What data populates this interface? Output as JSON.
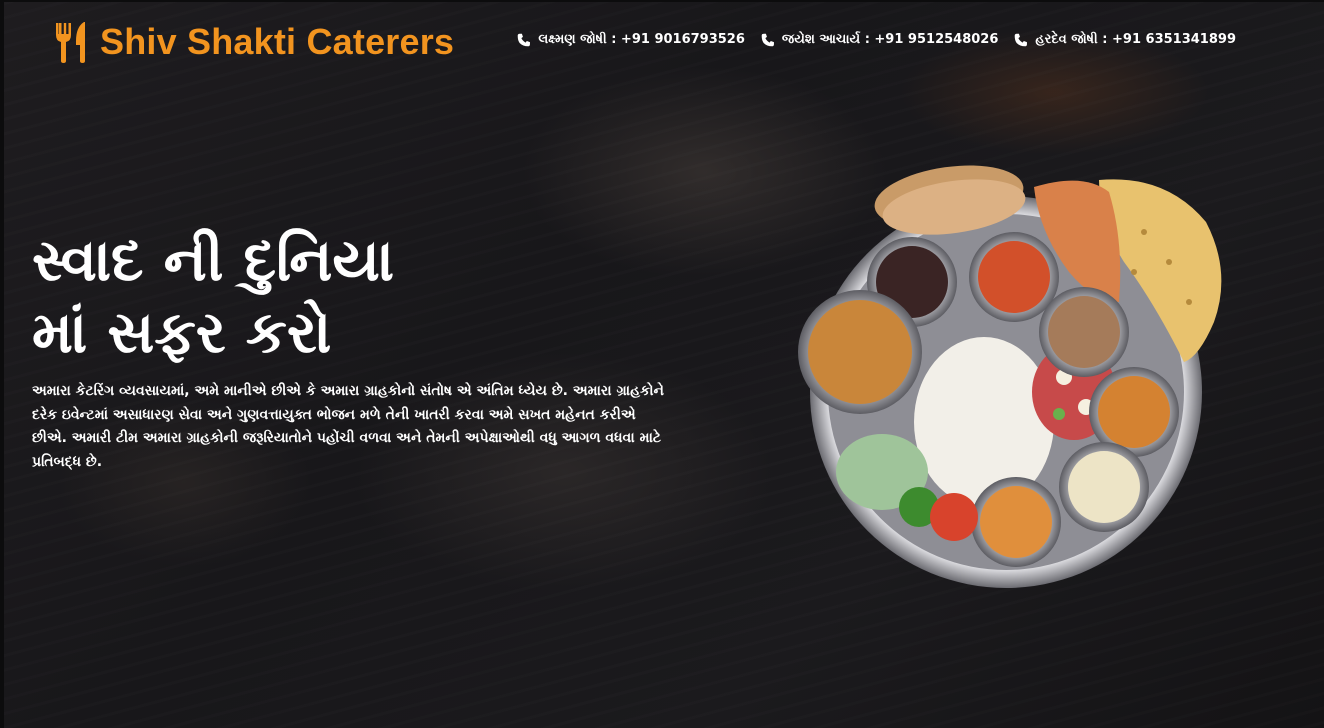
{
  "brand": {
    "name": "Shiv Shakti Caterers",
    "logo_icon": "fork-knife-icon",
    "color": "#f2941f"
  },
  "contacts": [
    {
      "icon": "phone-icon",
      "label": "લક્ષ્મણ જોષી : +91 9016793526"
    },
    {
      "icon": "phone-icon",
      "label": "જયેશ આચાર્ય : +91 9512548026"
    },
    {
      "icon": "phone-icon",
      "label": "હરદેવ જોષી : +91 6351341899"
    }
  ],
  "hero": {
    "title_line1": "સ્વાદ ની દુનિયા",
    "title_line2": "માં સફર કરો",
    "description": "અમારા કેટરિંગ વ્યવસાયમાં, અમે માનીએ છીએ કે અમારા ગ્રાહકોનો સંતોષ એ અંતિમ ધ્યેય છે. અમારા ગ્રાહકોને દરેક ઇવેન્ટમાં અસાધારણ સેવા અને ગુણવત્તાયુક્ત ભોજન મળે તેની ખાતરી કરવા અમે સખત મહેનત કરીએ છીએ. અમારી ટીમ અમારા ગ્રાહકોની જરૂરિયાતોને પહોંચી વળવા અને તેમની અપેક્ષાઓથી વધુ આગળ વધવા માટે પ્રતિબદ્ધ છે.",
    "image": "thali-plate-image"
  },
  "colors": {
    "background": "#18171a",
    "text": "#ffffff",
    "accent": "#f2941f"
  }
}
